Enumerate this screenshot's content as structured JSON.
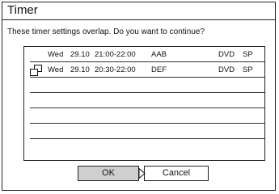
{
  "dialog": {
    "title": "Timer",
    "message": "These timer settings overlap. Do you want to continue?"
  },
  "timer_list": {
    "rows": [
      {
        "overlap": false,
        "day": "Wed",
        "date": "29.10",
        "time": "21:00-22:00",
        "channel": "AAB",
        "media": "DVD",
        "mode": "SP"
      },
      {
        "overlap": true,
        "day": "Wed",
        "date": "29.10",
        "time": "20:30-22:00",
        "channel": "DEF",
        "media": "DVD",
        "mode": "SP"
      },
      {
        "overlap": false,
        "day": "",
        "date": "",
        "time": "",
        "channel": "",
        "media": "",
        "mode": ""
      },
      {
        "overlap": false,
        "day": "",
        "date": "",
        "time": "",
        "channel": "",
        "media": "",
        "mode": ""
      },
      {
        "overlap": false,
        "day": "",
        "date": "",
        "time": "",
        "channel": "",
        "media": "",
        "mode": ""
      },
      {
        "overlap": false,
        "day": "",
        "date": "",
        "time": "",
        "channel": "",
        "media": "",
        "mode": ""
      },
      {
        "overlap": false,
        "day": "",
        "date": "",
        "time": "",
        "channel": "",
        "media": "",
        "mode": ""
      }
    ]
  },
  "buttons": {
    "ok_label": "OK",
    "cancel_label": "Cancel",
    "selected": "ok"
  },
  "icons": {
    "overlap": "overlap-icon",
    "cursor": "cursor-arrow-icon"
  },
  "colors": {
    "selected_button": "#cfcfcf",
    "border": "#222222"
  }
}
